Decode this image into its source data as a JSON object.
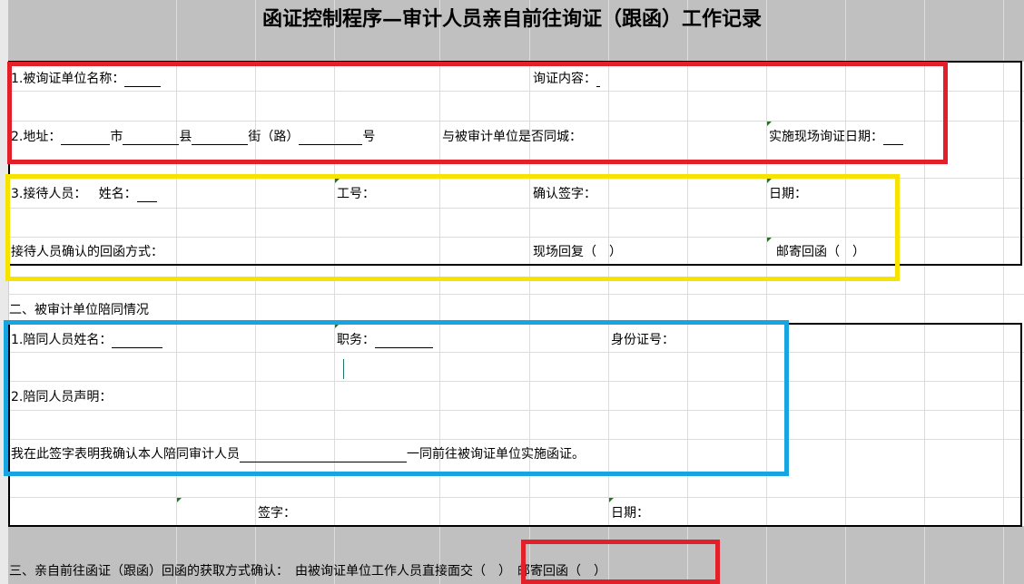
{
  "title": "函证控制程序—审计人员亲自前往询证（跟函）工作记录",
  "section1": {
    "name_label": "1.被询证单位名称：",
    "content_label": "询证内容：",
    "address_label": "2.地址：",
    "city": "市",
    "county": "县",
    "street": "街（路）",
    "number": "号",
    "same_city_label": "与被审计单位是否同城：",
    "visit_date_label": "实施现场询证日期："
  },
  "reception": {
    "staff_label": "3.接待人员：",
    "name_label": "姓名：",
    "id_label": "工号：",
    "confirm_sign_label": "确认签字：",
    "date_label": "日期：",
    "reply_method_label": "接待人员确认的回函方式：",
    "onsite_reply": "现场回复（　）",
    "mail_reply": "邮寄回函（　）"
  },
  "section2": {
    "header": "二、被审计单位陪同情况",
    "companion_name_label": "1.陪同人员姓名：",
    "position_label": "职务：",
    "id_number_label": "身份证号：",
    "statement_label": "2.陪同人员声明：",
    "statement_text_pre": "我在此签字表明我确认本人陪同审计人员",
    "statement_text_post": "一同前往被询证单位实施函证。",
    "signature_label": "签字：",
    "date_label": "日期："
  },
  "section3": {
    "text": "三、亲自前往函证（跟函）回函的获取方式确认：　由被询证单位工作人员直接面交（　）　邮寄回函（　）"
  }
}
